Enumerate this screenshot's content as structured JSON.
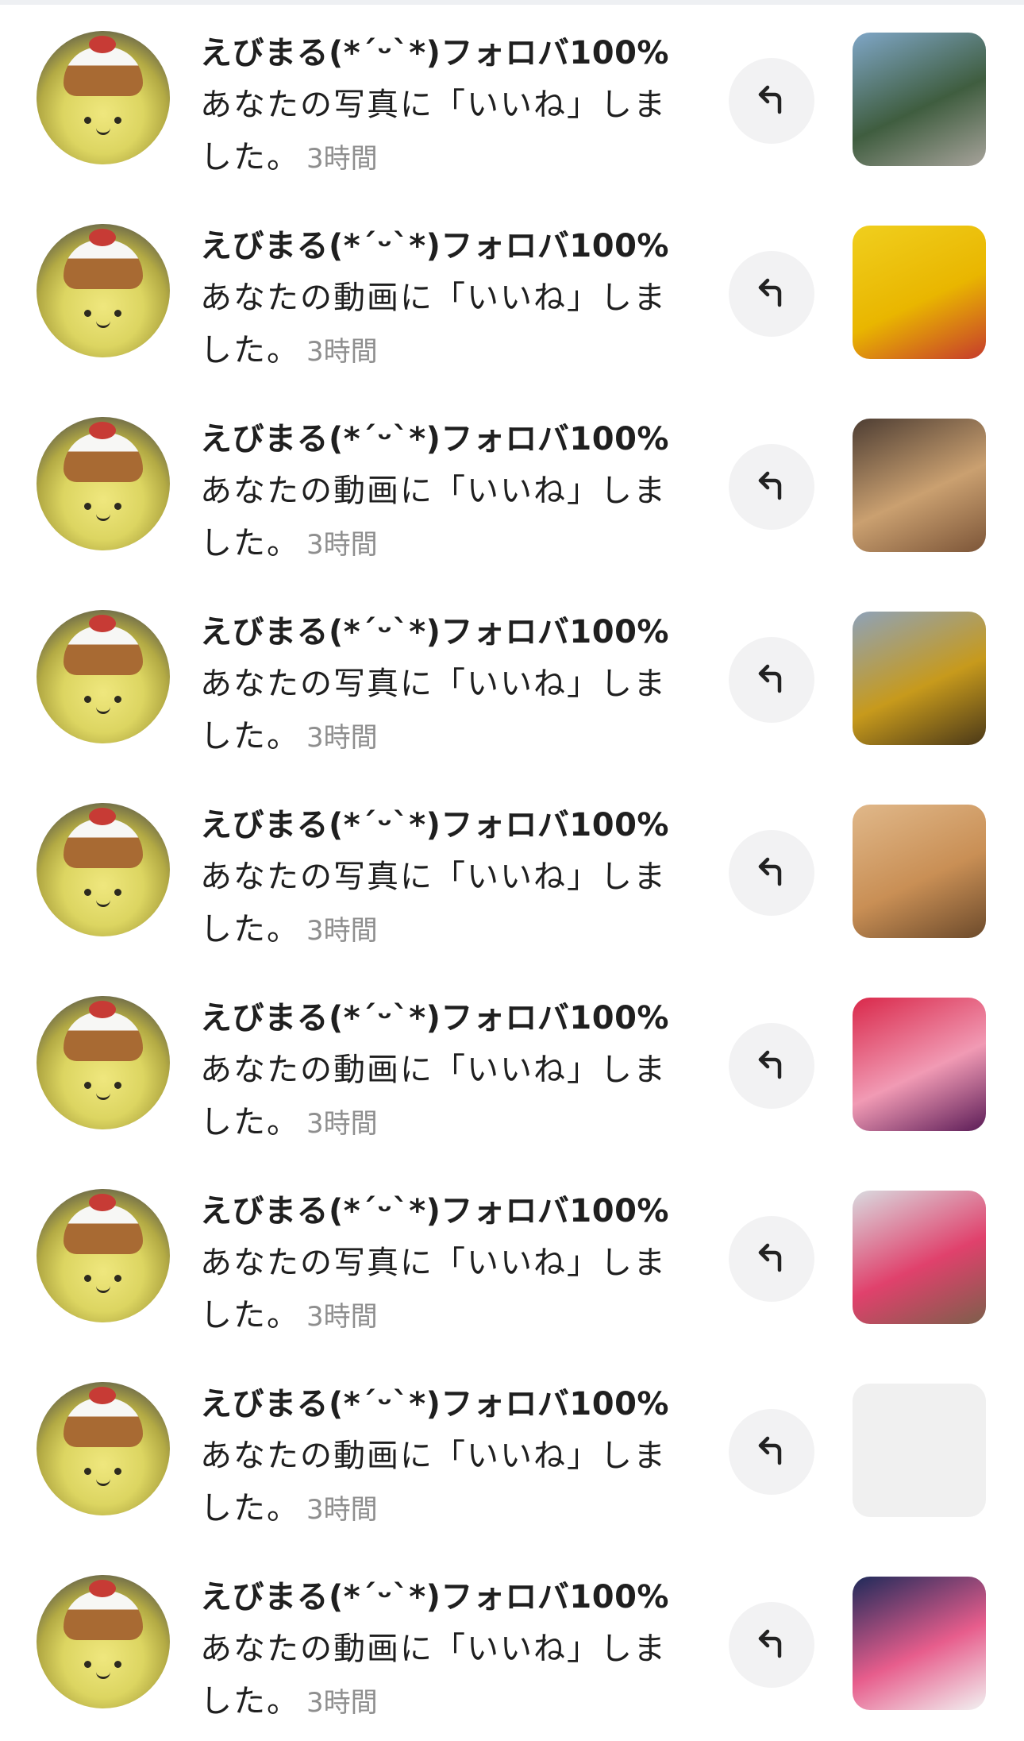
{
  "notifications": [
    {
      "username": "えびまる(*´ᵕ`*)フォロバ100%",
      "message": "あなたの写真に「いいね」しました。",
      "time": "3時間",
      "thumb_icon": "seaside-monument-photo",
      "thumb_colors": [
        "#7fa6c7",
        "#3f5d3f",
        "#a7a39b"
      ]
    },
    {
      "username": "えびまる(*´ᵕ`*)フォロバ100%",
      "message": "あなたの動画に「いいね」しました。",
      "time": "3時間",
      "thumb_icon": "yellow-flyer-photo",
      "thumb_colors": [
        "#f0cf1e",
        "#e9b600",
        "#c63b2c"
      ]
    },
    {
      "username": "えびまる(*´ᵕ`*)フォロバ100%",
      "message": "あなたの動画に「いいね」しました。",
      "time": "3時間",
      "thumb_icon": "takoyaki-pack-photo",
      "thumb_colors": [
        "#4d3d33",
        "#caa070",
        "#7c5538"
      ]
    },
    {
      "username": "えびまる(*´ᵕ`*)フォロバ100%",
      "message": "あなたの写真に「いいね」しました。",
      "time": "3時間",
      "thumb_icon": "candy-bags-photo",
      "thumb_colors": [
        "#8ea2b9",
        "#c79a1c",
        "#4a3818"
      ]
    },
    {
      "username": "えびまる(*´ᵕ`*)フォロバ100%",
      "message": "あなたの写真に「いいね」しました。",
      "time": "3時間",
      "thumb_icon": "bento-box-photo",
      "thumb_colors": [
        "#e0b88a",
        "#c98f55",
        "#6c4a2b"
      ]
    },
    {
      "username": "えびまる(*´ᵕ`*)フォロバ100%",
      "message": "あなたの動画に「いいね」しました。",
      "time": "3時間",
      "thumb_icon": "red-package-photo",
      "thumb_colors": [
        "#d9284a",
        "#f19ab4",
        "#5b1c57"
      ]
    },
    {
      "username": "えびまる(*´ᵕ`*)フォロバ100%",
      "message": "あなたの写真に「いいね」しました。",
      "time": "3時間",
      "thumb_icon": "cake-and-drink-photo",
      "thumb_colors": [
        "#d9dbe0",
        "#e0416c",
        "#7d5f4b"
      ]
    },
    {
      "username": "えびまる(*´ᵕ`*)フォロバ100%",
      "message": "あなたの動画に「いいね」しました。",
      "time": "3時間",
      "thumb_icon": "blank-thumbnail",
      "thumb_colors": [
        "#f0f0f0",
        "#f0f0f0",
        "#f0f0f0"
      ]
    },
    {
      "username": "えびまる(*´ᵕ`*)フォロバ100%",
      "message": "あなたの動画に「いいね」しました。",
      "time": "3時間",
      "thumb_icon": "plate-with-sign-photo",
      "thumb_colors": [
        "#1e2a5a",
        "#e75d8c",
        "#f2f2f2"
      ]
    }
  ]
}
